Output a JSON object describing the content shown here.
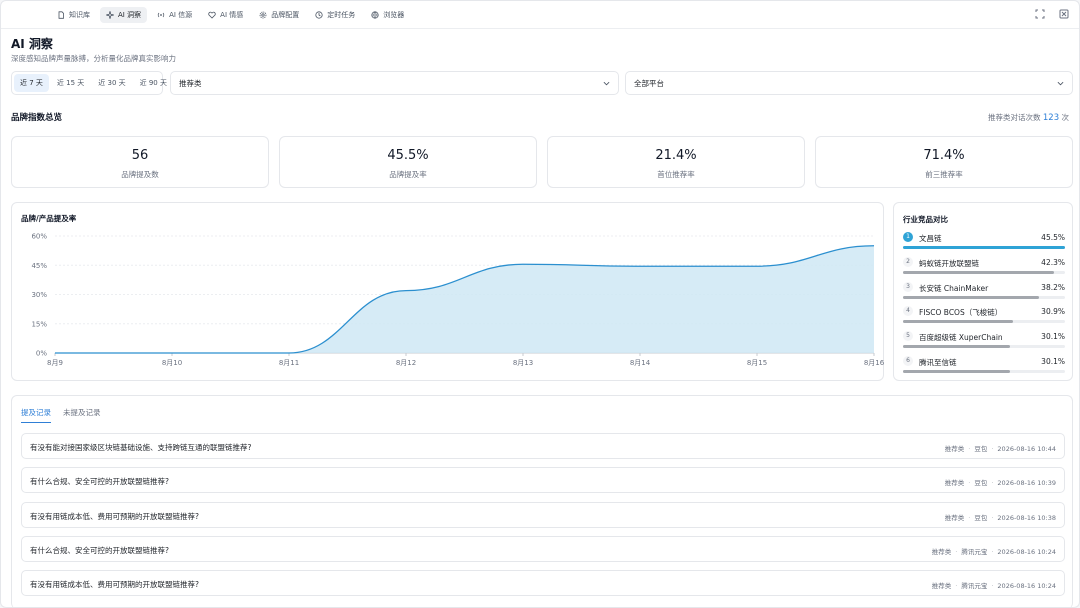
{
  "nav": {
    "tabs": [
      {
        "label": "知识库",
        "icon": "document-icon",
        "active": false
      },
      {
        "label": "AI 洞察",
        "icon": "sparkle-icon",
        "active": true
      },
      {
        "label": "AI 信源",
        "icon": "broadcast-icon",
        "active": false
      },
      {
        "label": "AI 情感",
        "icon": "heart-icon",
        "active": false
      },
      {
        "label": "品牌配置",
        "icon": "gear-icon",
        "active": false
      },
      {
        "label": "定时任务",
        "icon": "clock-icon",
        "active": false
      },
      {
        "label": "浏览器",
        "icon": "globe-icon",
        "active": false
      }
    ]
  },
  "header": {
    "title": "AI 洞察",
    "subtitle": "深度感知品牌声量脉搏，分析量化品牌真实影响力"
  },
  "filters": {
    "ranges": [
      "近 7 天",
      "近 15 天",
      "近 30 天",
      "近 90 天"
    ],
    "active_range": 0,
    "category": "推荐类",
    "platform": "全部平台"
  },
  "overview": {
    "title": "品牌指数总览",
    "conv_label": "推荐类对话次数",
    "conv_count": "123",
    "conv_unit": "次",
    "kpis": [
      {
        "value": "56",
        "label": "品牌提及数"
      },
      {
        "value": "45.5%",
        "label": "品牌提及率"
      },
      {
        "value": "21.4%",
        "label": "首位推荐率"
      },
      {
        "value": "71.4%",
        "label": "前三推荐率"
      }
    ]
  },
  "chart_data": {
    "type": "area",
    "title": "品牌/产品提及率",
    "x": [
      "8月9",
      "8月10",
      "8月11",
      "8月12",
      "8月13",
      "8月14",
      "8月15",
      "8月16"
    ],
    "values": [
      0,
      0,
      0,
      32,
      45.5,
      44.5,
      44.5,
      55
    ],
    "yticks": [
      "0%",
      "15%",
      "30%",
      "45%",
      "60%"
    ],
    "ylim": [
      0,
      60
    ],
    "grid": true,
    "color": "#2b8fcf",
    "fill": "#cfe7f5"
  },
  "competitors": {
    "title": "行业竞品对比",
    "items": [
      {
        "rank": "1",
        "name": "文昌链",
        "value": "45.5%",
        "pct": 45.5
      },
      {
        "rank": "2",
        "name": "蚂蚁链开放联盟链",
        "value": "42.3%",
        "pct": 42.3
      },
      {
        "rank": "3",
        "name": "长安链 ChainMaker",
        "value": "38.2%",
        "pct": 38.2
      },
      {
        "rank": "4",
        "name": "FISCO BCOS（飞梭链）",
        "value": "30.9%",
        "pct": 30.9
      },
      {
        "rank": "5",
        "name": "百度超级链 XuperChain",
        "value": "30.1%",
        "pct": 30.1
      },
      {
        "rank": "6",
        "name": "腾讯至信链",
        "value": "30.1%",
        "pct": 30.1
      }
    ]
  },
  "records": {
    "tabs": [
      "提及记录",
      "未提及记录"
    ],
    "active_tab": 0,
    "items": [
      {
        "question": "有没有能对接国家级区块链基础设施、支持跨链互通的联盟链推荐?",
        "category": "推荐类",
        "source": "豆包",
        "time": "2026-08-16 10:44"
      },
      {
        "question": "有什么合规、安全可控的开放联盟链推荐?",
        "category": "推荐类",
        "source": "豆包",
        "time": "2026-08-16 10:39"
      },
      {
        "question": "有没有用链成本低、费用可预期的开放联盟链推荐?",
        "category": "推荐类",
        "source": "豆包",
        "time": "2026-08-16 10:38"
      },
      {
        "question": "有什么合规、安全可控的开放联盟链推荐?",
        "category": "推荐类",
        "source": "腾讯元宝",
        "time": "2026-08-16 10:24"
      },
      {
        "question": "有没有用链成本低、费用可预期的开放联盟链推荐?",
        "category": "推荐类",
        "source": "腾讯元宝",
        "time": "2026-08-16 10:24"
      }
    ]
  }
}
